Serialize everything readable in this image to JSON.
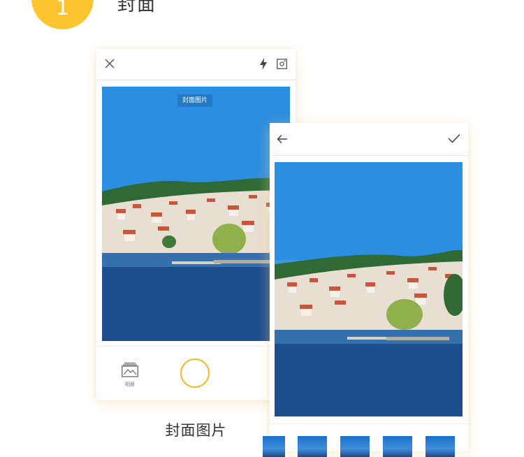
{
  "step": {
    "number": "1",
    "title": "封面"
  },
  "camera_screen": {
    "cover_tag": "封面图片",
    "album_label": "相册"
  },
  "caption": "封面图片",
  "colors": {
    "accent": "#fcc530",
    "shutter": "#f5b824",
    "sky": "#1f86d8",
    "water": "#1b4c8c"
  }
}
